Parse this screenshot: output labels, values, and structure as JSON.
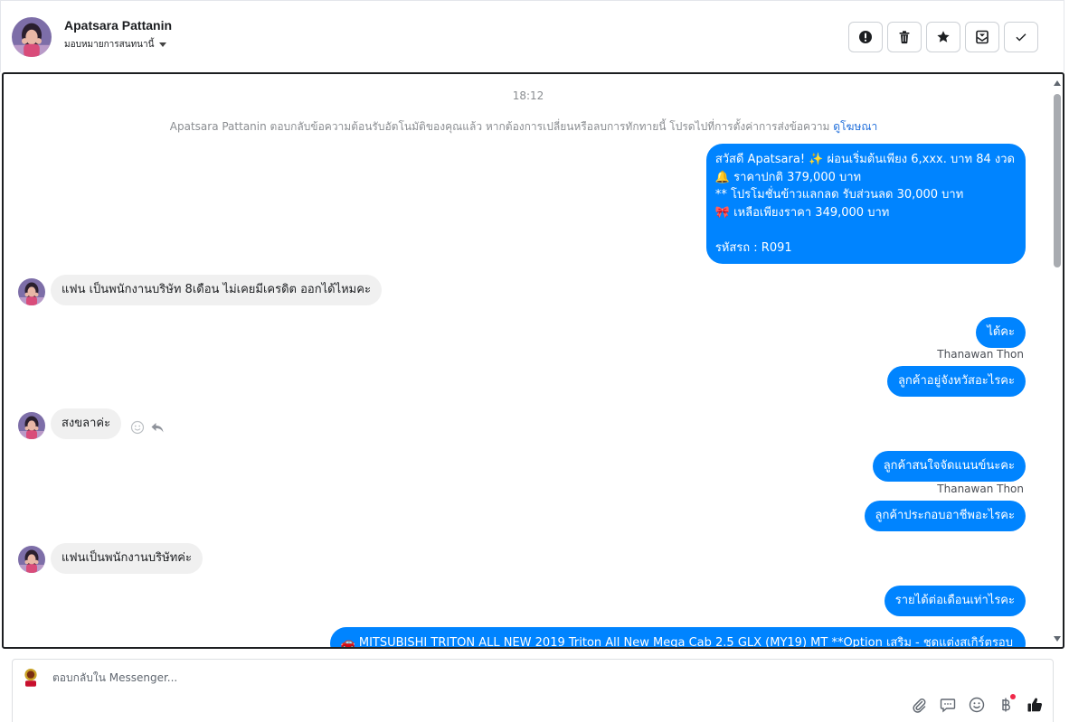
{
  "header": {
    "name": "Apatsara Pattanin",
    "assign_label": "มอบหมายการสนทนานี้"
  },
  "toolbar": {
    "buttons": [
      "exclamation-icon",
      "trash-icon",
      "star-icon",
      "mark-unread-icon",
      "check-icon"
    ]
  },
  "conversation": {
    "time": "18:12",
    "notice_text": "Apatsara Pattanin ตอบกลับข้อความต้อนรับอัตโนมัติของคุณแล้ว หากต้องการเปลี่ยนหรือลบการทักทายนี้ โปรดไปที่การตั้งค่าการส่งข้อความ",
    "notice_link": "ดูโฆษณา",
    "messages": [
      {
        "dir": "out",
        "lines": [
          "สวัสดี Apatsara! ✨  ผ่อนเริ่มต้นเพียง 6,xxx. บาท 84 งวด",
          "🔔 ราคาปกติ 379,000 บาท",
          "** โปรโมชั่นข้าวแลกลด รับส่วนลด 30,000 บาท",
          "🎀  เหลือเพียงราคา 349,000 บาท",
          "",
          " รหัสรถ : R091"
        ]
      },
      {
        "dir": "in",
        "text": "แฟน เป็นพนักงานบริษัท 8เดือน ไม่เคยมีเครดิต ออกได้ไหมคะ"
      },
      {
        "dir": "out",
        "text": "ได้คะ"
      },
      {
        "dir": "sender",
        "text": "Thanawan Thon"
      },
      {
        "dir": "out",
        "text": "ลูกค้าอยู่จังหวัสอะไรคะ"
      },
      {
        "dir": "in",
        "text": "สงขลาค่ะ"
      },
      {
        "dir": "out",
        "text": "ลูกค้าสนใจจัดแนนข์นะคะ"
      },
      {
        "dir": "sender",
        "text": "Thanawan Thon"
      },
      {
        "dir": "out",
        "text": "ลูกค้าประกอบอาชีพอะไรคะ"
      },
      {
        "dir": "in",
        "text": "แฟนเป็นพนักงานบริษัทค่ะ"
      },
      {
        "dir": "out",
        "text": "รายได้ต่อเดือนเท่าไรคะ"
      },
      {
        "dir": "out",
        "text": "🚗  MITSUBISHI TRITON ALL NEW 2019 Triton All New Mega Cab 2.5 GLX (MY19) MT **Option เสริม - ชุดแต่งสเกิร์ตรอบ"
      }
    ]
  },
  "composer": {
    "placeholder": "ตอบกลับใน Messenger..."
  },
  "colors": {
    "outgoing_bubble": "#0084ff",
    "incoming_bubble": "#f0f0f0",
    "link": "#216fdb",
    "notification_dot": "#f02849"
  }
}
